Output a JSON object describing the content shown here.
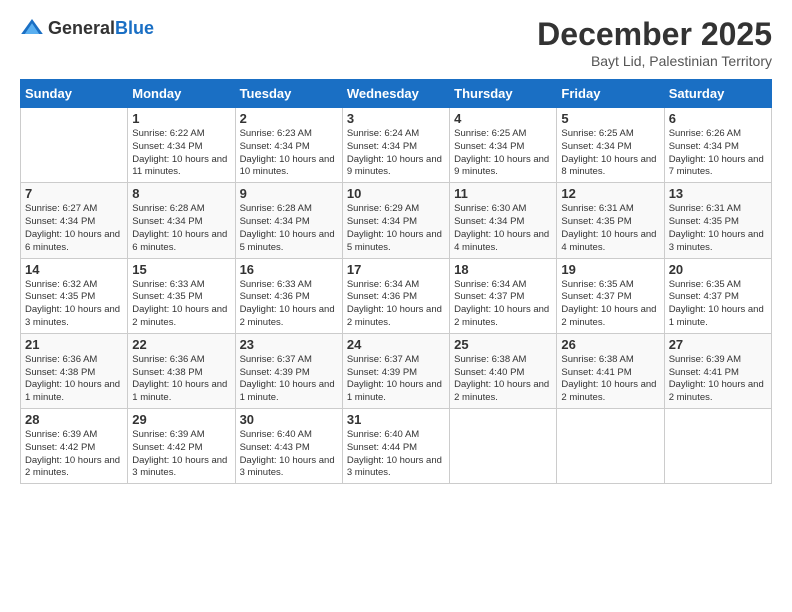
{
  "logo": {
    "general": "General",
    "blue": "Blue"
  },
  "title": {
    "month": "December 2025",
    "location": "Bayt Lid, Palestinian Territory"
  },
  "headers": [
    "Sunday",
    "Monday",
    "Tuesday",
    "Wednesday",
    "Thursday",
    "Friday",
    "Saturday"
  ],
  "weeks": [
    [
      {
        "day": "",
        "info": ""
      },
      {
        "day": "1",
        "info": "Sunrise: 6:22 AM\nSunset: 4:34 PM\nDaylight: 10 hours and 11 minutes."
      },
      {
        "day": "2",
        "info": "Sunrise: 6:23 AM\nSunset: 4:34 PM\nDaylight: 10 hours and 10 minutes."
      },
      {
        "day": "3",
        "info": "Sunrise: 6:24 AM\nSunset: 4:34 PM\nDaylight: 10 hours and 9 minutes."
      },
      {
        "day": "4",
        "info": "Sunrise: 6:25 AM\nSunset: 4:34 PM\nDaylight: 10 hours and 9 minutes."
      },
      {
        "day": "5",
        "info": "Sunrise: 6:25 AM\nSunset: 4:34 PM\nDaylight: 10 hours and 8 minutes."
      },
      {
        "day": "6",
        "info": "Sunrise: 6:26 AM\nSunset: 4:34 PM\nDaylight: 10 hours and 7 minutes."
      }
    ],
    [
      {
        "day": "7",
        "info": "Sunrise: 6:27 AM\nSunset: 4:34 PM\nDaylight: 10 hours and 6 minutes."
      },
      {
        "day": "8",
        "info": "Sunrise: 6:28 AM\nSunset: 4:34 PM\nDaylight: 10 hours and 6 minutes."
      },
      {
        "day": "9",
        "info": "Sunrise: 6:28 AM\nSunset: 4:34 PM\nDaylight: 10 hours and 5 minutes."
      },
      {
        "day": "10",
        "info": "Sunrise: 6:29 AM\nSunset: 4:34 PM\nDaylight: 10 hours and 5 minutes."
      },
      {
        "day": "11",
        "info": "Sunrise: 6:30 AM\nSunset: 4:34 PM\nDaylight: 10 hours and 4 minutes."
      },
      {
        "day": "12",
        "info": "Sunrise: 6:31 AM\nSunset: 4:35 PM\nDaylight: 10 hours and 4 minutes."
      },
      {
        "day": "13",
        "info": "Sunrise: 6:31 AM\nSunset: 4:35 PM\nDaylight: 10 hours and 3 minutes."
      }
    ],
    [
      {
        "day": "14",
        "info": "Sunrise: 6:32 AM\nSunset: 4:35 PM\nDaylight: 10 hours and 3 minutes."
      },
      {
        "day": "15",
        "info": "Sunrise: 6:33 AM\nSunset: 4:35 PM\nDaylight: 10 hours and 2 minutes."
      },
      {
        "day": "16",
        "info": "Sunrise: 6:33 AM\nSunset: 4:36 PM\nDaylight: 10 hours and 2 minutes."
      },
      {
        "day": "17",
        "info": "Sunrise: 6:34 AM\nSunset: 4:36 PM\nDaylight: 10 hours and 2 minutes."
      },
      {
        "day": "18",
        "info": "Sunrise: 6:34 AM\nSunset: 4:37 PM\nDaylight: 10 hours and 2 minutes."
      },
      {
        "day": "19",
        "info": "Sunrise: 6:35 AM\nSunset: 4:37 PM\nDaylight: 10 hours and 2 minutes."
      },
      {
        "day": "20",
        "info": "Sunrise: 6:35 AM\nSunset: 4:37 PM\nDaylight: 10 hours and 1 minute."
      }
    ],
    [
      {
        "day": "21",
        "info": "Sunrise: 6:36 AM\nSunset: 4:38 PM\nDaylight: 10 hours and 1 minute."
      },
      {
        "day": "22",
        "info": "Sunrise: 6:36 AM\nSunset: 4:38 PM\nDaylight: 10 hours and 1 minute."
      },
      {
        "day": "23",
        "info": "Sunrise: 6:37 AM\nSunset: 4:39 PM\nDaylight: 10 hours and 1 minute."
      },
      {
        "day": "24",
        "info": "Sunrise: 6:37 AM\nSunset: 4:39 PM\nDaylight: 10 hours and 1 minute."
      },
      {
        "day": "25",
        "info": "Sunrise: 6:38 AM\nSunset: 4:40 PM\nDaylight: 10 hours and 2 minutes."
      },
      {
        "day": "26",
        "info": "Sunrise: 6:38 AM\nSunset: 4:41 PM\nDaylight: 10 hours and 2 minutes."
      },
      {
        "day": "27",
        "info": "Sunrise: 6:39 AM\nSunset: 4:41 PM\nDaylight: 10 hours and 2 minutes."
      }
    ],
    [
      {
        "day": "28",
        "info": "Sunrise: 6:39 AM\nSunset: 4:42 PM\nDaylight: 10 hours and 2 minutes."
      },
      {
        "day": "29",
        "info": "Sunrise: 6:39 AM\nSunset: 4:42 PM\nDaylight: 10 hours and 3 minutes."
      },
      {
        "day": "30",
        "info": "Sunrise: 6:40 AM\nSunset: 4:43 PM\nDaylight: 10 hours and 3 minutes."
      },
      {
        "day": "31",
        "info": "Sunrise: 6:40 AM\nSunset: 4:44 PM\nDaylight: 10 hours and 3 minutes."
      },
      {
        "day": "",
        "info": ""
      },
      {
        "day": "",
        "info": ""
      },
      {
        "day": "",
        "info": ""
      }
    ]
  ]
}
